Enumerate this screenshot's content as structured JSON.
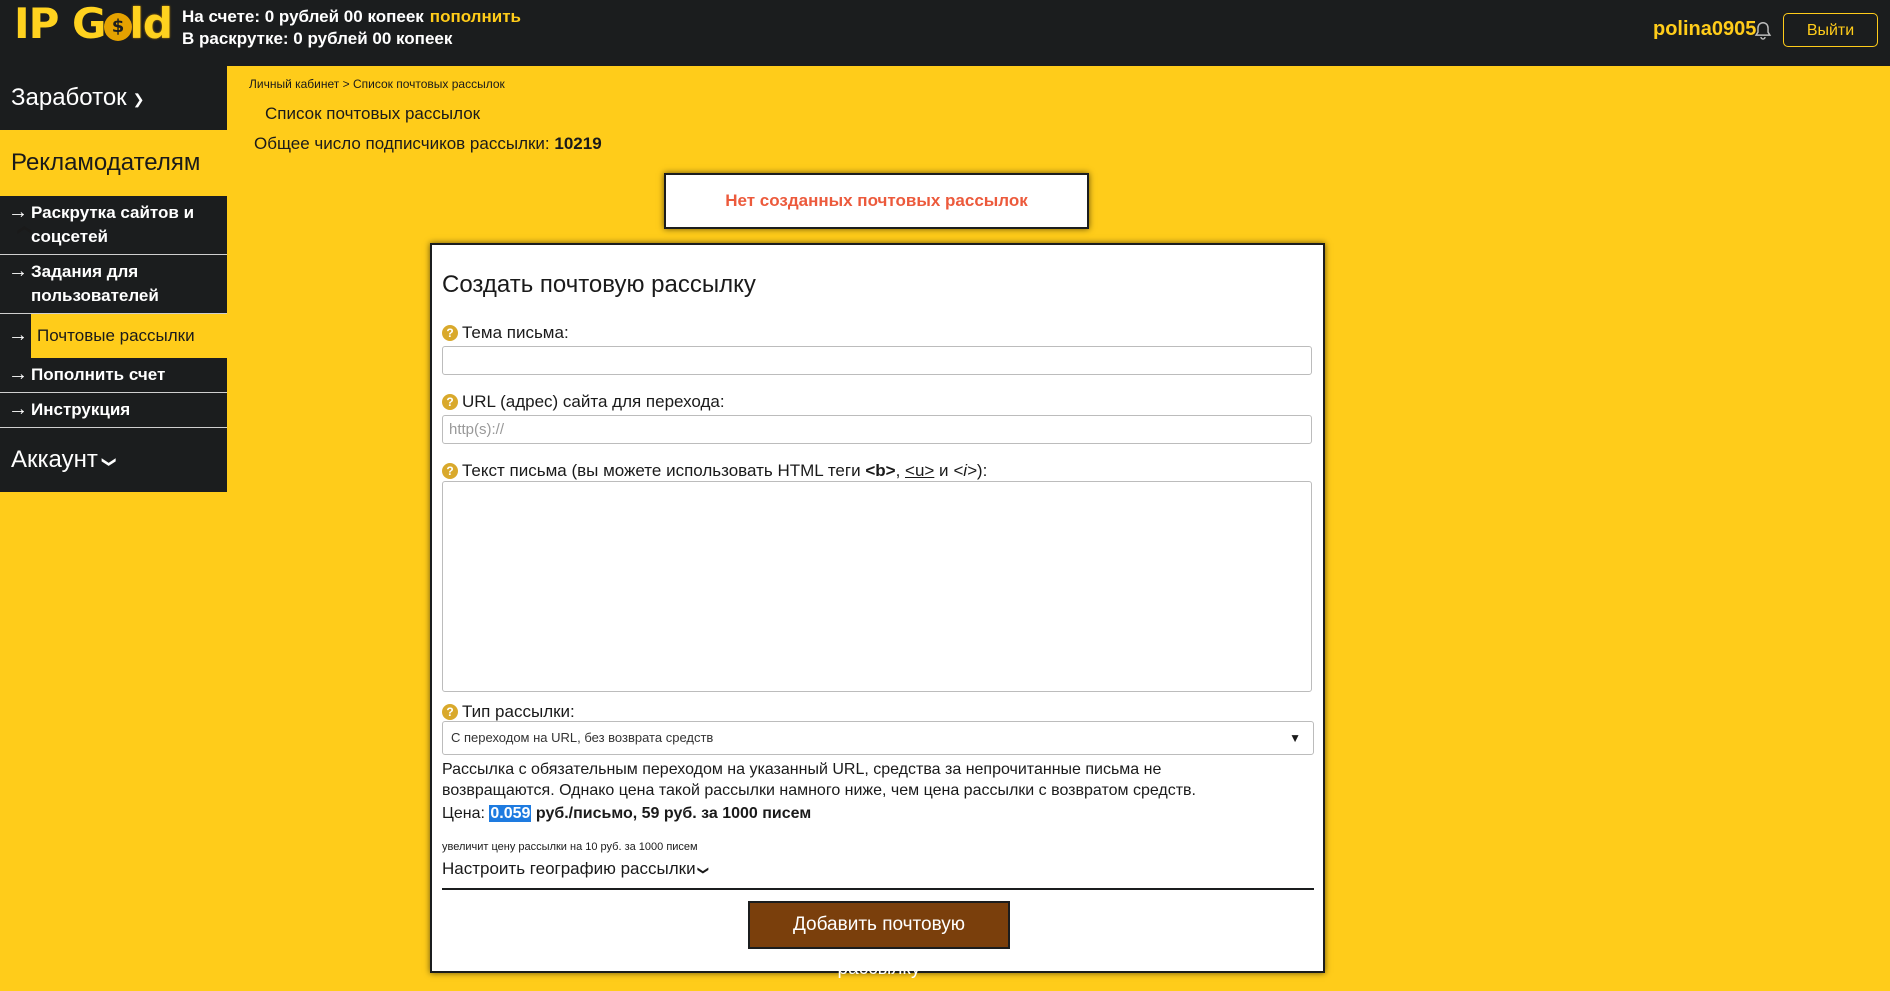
{
  "header": {
    "logo_ip": "IP G",
    "logo_coin": "$",
    "logo_rest": "ld",
    "balance_label": "На счете: 0 рублей 00 копеек",
    "topup_link": "пополнить",
    "promo_label": "В раскрутке: 0 рублей 00 копеек",
    "username": "polina0905",
    "logout": "Выйти"
  },
  "sidebar": {
    "earnings": "Заработок",
    "advertisers": "Рекламодателям",
    "items": [
      {
        "label": "Раскрутка сайтов и соцсетей"
      },
      {
        "label": "Задания для пользователей"
      },
      {
        "label": "Почтовые рассылки"
      },
      {
        "label": "Пополнить счет"
      },
      {
        "label": "Инструкция"
      }
    ],
    "account": "Аккаунт"
  },
  "main": {
    "breadcrumb": "Личный кабинет > Список почтовых рассылок",
    "page_title": "Список почтовых рассылок",
    "subscribers_label": "Общее число подписчиков рассылки:",
    "subscribers_count": "10219",
    "empty_notice": "Нет созданных почтовых рассылок"
  },
  "form": {
    "title": "Создать почтовую рассылку",
    "subject_label": "Тема письма:",
    "subject_value": "",
    "url_label": "URL (адрес) сайта для перехода:",
    "url_placeholder": "http(s)://",
    "text_label_pre": "Текст письма (вы можете использовать HTML теги ",
    "tag_b": "<b>",
    "tag_u": "<u>",
    "tag_and": " и ",
    "tag_i": "<i>",
    "text_label_post": "):",
    "type_label": "Тип рассылки:",
    "type_selected": "С переходом на URL, без возврата средств",
    "type_description": "Рассылка с обязательным переходом на указанный URL, средства за непрочитанные письма не возвращаются. Однако цена такой рассылки намного ниже, чем цена рассылки с возвратом средств.",
    "price_label": "Цена:",
    "price_value": "0.059",
    "price_rest": "руб./письмо, 59 руб. за 1000 писем",
    "geo_note": "увеличит цену рассылки на 10 руб. за 1000 писем",
    "geo_link": "Настроить географию рассылки",
    "submit": "Добавить почтовую рассылку"
  }
}
